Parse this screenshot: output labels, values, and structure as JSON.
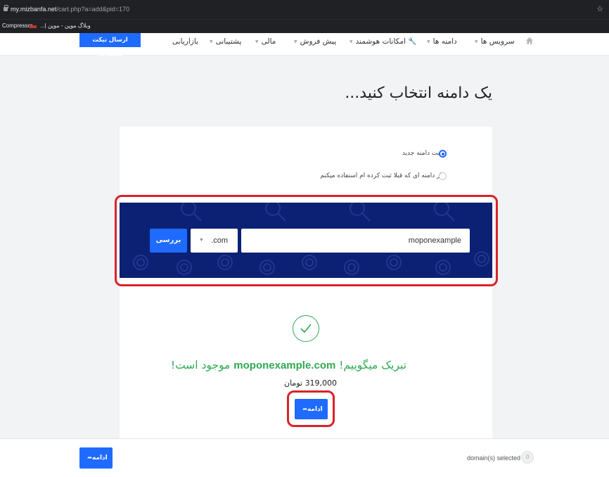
{
  "browser": {
    "url_host": "my.mizbanfa.net",
    "url_path": "/cart.php?a=add&pid=170",
    "bookmarks": [
      {
        "label": "Compressor"
      },
      {
        "label": "وبلاگ موپن - موپن |..."
      }
    ]
  },
  "nav": {
    "support_button": "ارسال تیکت پشتیبانی",
    "items": [
      {
        "label": "سرویس ها"
      },
      {
        "label": "دامنه ها"
      },
      {
        "label": "امکانات هوشمند"
      },
      {
        "label": "پیش فروش"
      },
      {
        "label": "مالی"
      },
      {
        "label": "پشتیبانی"
      },
      {
        "label": "بازاریابی"
      }
    ]
  },
  "page": {
    "title": "یک دامنه انتخاب کنید..."
  },
  "domain_options": [
    {
      "label": "ثبت دامنه جدید",
      "selected": true
    },
    {
      "label": "از دامنه ای که قبلا ثبت کرده ام استفاده میکنم",
      "selected": false
    }
  ],
  "search": {
    "domain_value": "moponexample",
    "tld_value": ".com",
    "check_label": "بررسی"
  },
  "result": {
    "message_prefix": "تبریک میگوییم!",
    "domain": "moponexample.com",
    "message_suffix": "موجود است!",
    "price": "319,000 تومان",
    "continue_label": "ادامه"
  },
  "footer": {
    "continue_label": "ادامه",
    "selected_text": "domain(s) selected",
    "selected_count": "0"
  },
  "colors": {
    "accent": "#1f6bff",
    "banner": "#0c2074",
    "success": "#2eaa53",
    "highlight": "#d8232a"
  }
}
